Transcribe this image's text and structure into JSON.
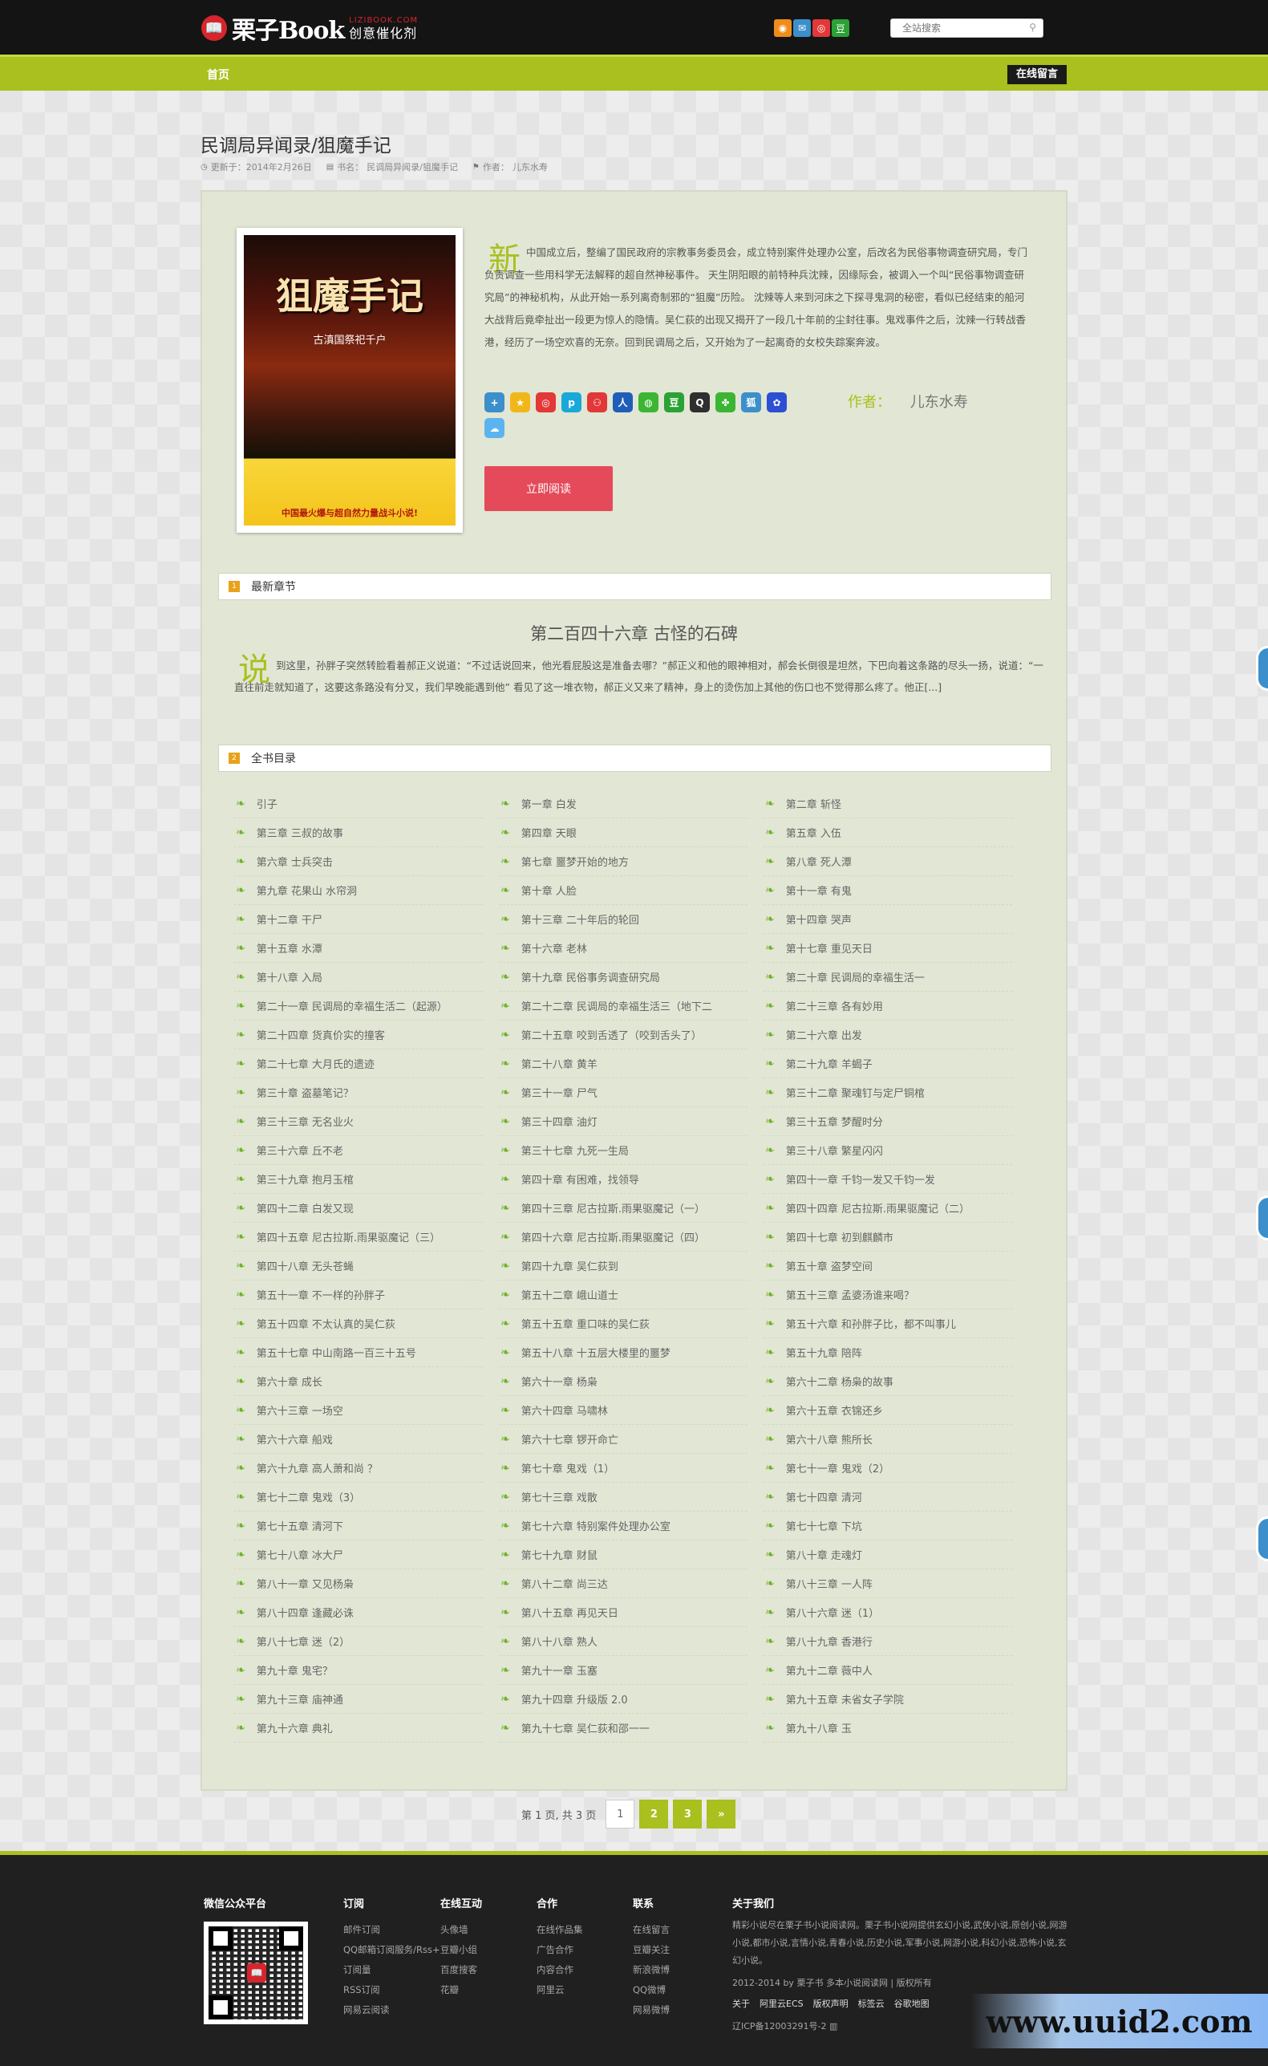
{
  "header": {
    "logo_main": "栗子Book",
    "logo_url": "LIZIBOOK.COM",
    "logo_slogan": "创意催化剂",
    "social": [
      {
        "name": "rss-icon",
        "color": "#f08c1b",
        "glyph": "◉"
      },
      {
        "name": "mail-icon",
        "color": "#3c8fcb",
        "glyph": "✉"
      },
      {
        "name": "weibo-icon",
        "color": "#e23838",
        "glyph": "◎"
      },
      {
        "name": "douban-icon",
        "color": "#2aa235",
        "glyph": "豆"
      }
    ],
    "search_placeholder": "全站搜索"
  },
  "nav": {
    "home": "首页",
    "message": "在线留言"
  },
  "article": {
    "title": "民调局异闻录/狙魔手记",
    "updated": "更新于：2014年2月26日",
    "book_label": "书名：",
    "book_name": "民调局异闻录/狙魔手记",
    "author_label": "作者：",
    "author_name": "儿东水寿"
  },
  "book": {
    "cover_title": "狙魔手记",
    "cover_sub": "古滇国祭祀千户",
    "cover_banner": "中国最火爆与超自然力量战斗小说!",
    "desc_char": "新",
    "description": "中国成立后，整编了国民政府的宗教事务委员会，成立特别案件处理办公室，后改名为民俗事物调查研究局，专门负责调查一些用科学无法解释的超自然神秘事件。        天生阴阳眼的前特种兵沈辣，因缘际会，被调入一个叫“民俗事物调查研究局”的神秘机构，从此开始一系列离奇制邪的“狙魔”历险。        沈辣等人来到河床之下探寻鬼洞的秘密，看似已经结束的船河大战背后竟牵扯出一段更为惊人的隐情。吴仁荻的出现又揭开了一段几十年前的尘封往事。鬼戏事件之后，沈辣一行转战香港，经历了一场空欢喜的无奈。回到民调局之后，又开始为了一起离奇的女校失踪案奔波。",
    "author_label": "作者：",
    "author_name": "儿东水寿",
    "read_button": "立即阅读",
    "share_icons": [
      {
        "name": "share-plus-icon",
        "color": "#3c8fcb",
        "glyph": "+"
      },
      {
        "name": "qzone-icon",
        "color": "#f1b71a",
        "glyph": "★"
      },
      {
        "name": "weibo-share-icon",
        "color": "#e23838",
        "glyph": "◎"
      },
      {
        "name": "tencent-weibo-icon",
        "color": "#19a9d8",
        "glyph": "p"
      },
      {
        "name": "renren-icon",
        "color": "#e23838",
        "glyph": "⚇"
      },
      {
        "name": "people-icon",
        "color": "#1e5eb8",
        "glyph": "人"
      },
      {
        "name": "wechat-icon",
        "color": "#3db534",
        "glyph": "◍"
      },
      {
        "name": "douban-share-icon",
        "color": "#2aa235",
        "glyph": "豆"
      },
      {
        "name": "qq-icon",
        "color": "#2f2f2f",
        "glyph": "Q"
      },
      {
        "name": "kaixin-icon",
        "color": "#3db534",
        "glyph": "✤"
      },
      {
        "name": "sohu-icon",
        "color": "#3c8fcb",
        "glyph": "狐"
      },
      {
        "name": "baidu-icon",
        "color": "#2c4fd3",
        "glyph": "✿"
      },
      {
        "name": "cloud-icon",
        "color": "#5bb4ef",
        "glyph": "☁"
      }
    ]
  },
  "latest": {
    "section_num": "1",
    "section_label": "最新章节",
    "chapter_title": "第二百四十六章  古怪的石碑",
    "drop_char": "说",
    "excerpt": "到这里，孙胖子突然转脸看着郝正义说道：“不过话说回来，他光看屁股这是准备去哪？”郝正义和他的眼神相对，郝会长倒很是坦然，下巴向着这条路的尽头一扬，说道：“一直往前走就知道了，这要这条路没有分叉，我们早晚能遇到他”        看见了这一堆衣物，郝正义又来了精神，身上的烫伤加上其他的伤口也不觉得那么疼了。他正[...]"
  },
  "catalog": {
    "section_num": "2",
    "section_label": "全书目录",
    "chapters": [
      "引子",
      "第一章 白发",
      "第二章 斩怪",
      "第三章 三叔的故事",
      "第四章 天眼",
      "第五章 入伍",
      "第六章 士兵突击",
      "第七章 噩梦开始的地方",
      "第八章 死人潭",
      "第九章 花果山 水帘洞",
      "第十章 人脸",
      "第十一章 有鬼",
      "第十二章 干尸",
      "第十三章 二十年后的轮回",
      "第十四章 哭声",
      "第十五章 水潭",
      "第十六章 老林",
      "第十七章 重见天日",
      "第十八章 入局",
      "第十九章 民俗事务调查研究局",
      "第二十章 民调局的幸福生活一",
      "第二十一章 民调局的幸福生活二（起源）",
      "第二十二章 民调局的幸福生活三（地下二",
      "第二十三章 各有妙用",
      "第二十四章 货真价实的撞客",
      "第二十五章 咬到舌透了（咬到舌头了）",
      "第二十六章 出发",
      "第二十七章 大月氏的遗迹",
      "第二十八章 黄羊",
      "第二十九章 羊蝎子",
      "第三十章 盗墓笔记？",
      "第三十一章 尸气",
      "第三十二章 聚魂钉与定尸铜棺",
      "第三十三章 无名业火",
      "第三十四章 油灯",
      "第三十五章 梦醒时分",
      "第三十六章 丘不老",
      "第三十七章 九死一生局",
      "第三十八章 繁星闪闪",
      "第三十九章 抱月玉棺",
      "第四十章 有困难，找领导",
      "第四十一章 千钧一发又千钧一发",
      "第四十二章 白发又现",
      "第四十三章 尼古拉斯.雨果驱魔记（一）",
      "第四十四章 尼古拉斯.雨果驱魔记（二）",
      "第四十五章 尼古拉斯.雨果驱魔记（三）",
      "第四十六章 尼古拉斯.雨果驱魔记（四）",
      "第四十七章 初到麒麟市",
      "第四十八章 无头苍蝇",
      "第四十九章 吴仁荻到",
      "第五十章 盗梦空间",
      "第五十一章 不一样的孙胖子",
      "第五十二章 峨山道士",
      "第五十三章 孟婆汤谁来喝？",
      "第五十四章 不太认真的吴仁荻",
      "第五十五章 重口味的吴仁荻",
      "第五十六章 和孙胖子比，都不叫事儿",
      "第五十七章 中山南路一百三十五号",
      "第五十八章 十五层大楼里的噩梦",
      "第五十九章 陪阵",
      "第六十章 成长",
      "第六十一章 杨枭",
      "第六十二章 杨枭的故事",
      "第六十三章 一场空",
      "第六十四章 马啸林",
      "第六十五章 衣锦还乡",
      "第六十六章 船戏",
      "第六十七章 锣开命亡",
      "第六十八章 熊所长",
      "第六十九章 高人萧和尚 ？",
      "第七十章 鬼戏（1）",
      "第七十一章 鬼戏（2）",
      "第七十二章 鬼戏（3）",
      "第七十三章 戏散",
      "第七十四章 清河",
      "第七十五章 清河下",
      "第七十六章 特别案件处理办公室",
      "第七十七章 下坑",
      "第七十八章 冰大尸",
      "第七十九章 财鼠",
      "第八十章 走魂灯",
      "第八十一章 又见杨枭",
      "第八十二章 尚三达",
      "第八十三章 一人阵",
      "第八十四章 逢藏必诛",
      "第八十五章 再见天日",
      "第八十六章 迷（1）",
      "第八十七章 迷（2）",
      "第八十八章 熟人",
      "第八十九章 香港行",
      "第九十章 鬼宅？",
      "第九十一章 玉塞",
      "第九十二章 薇中人",
      "第九十三章 庙神通",
      "第九十四章 升级版 2.0",
      "第九十五章 未省女子学院",
      "第九十六章 典礼",
      "第九十七章 吴仁荻和邵一一",
      "第九十八章 玉"
    ]
  },
  "pager": {
    "info": "第 1 页, 共 3 页",
    "pages": [
      "1",
      "2",
      "3",
      "»"
    ]
  },
  "footer": {
    "wechat_title": "微信公众平台",
    "columns": [
      {
        "title": "订阅",
        "links": [
          "邮件订阅",
          "QQ邮箱订阅服务/Rss+",
          "订阅量",
          "RSS订阅",
          "网易云阅读"
        ]
      },
      {
        "title": "在线互动",
        "links": [
          "头像墙",
          "豆瓣小组",
          "百度搜客",
          "花瓣"
        ]
      },
      {
        "title": "合作",
        "links": [
          "在线作品集",
          "广告合作",
          "内容合作",
          "阿里云"
        ]
      },
      {
        "title": "联系",
        "links": [
          "在线留言",
          "豆瓣关注",
          "新浪微博",
          "QQ微博",
          "网易微博"
        ]
      }
    ],
    "about_title": "关于我们",
    "about_text": "精彩小说尽在栗子书小说阅读网。栗子书小说网提供玄幻小说,武侠小说,原创小说,网游小说,都市小说,言情小说,青春小说,历史小说,军事小说,网游小说,科幻小说,恐怖小说,玄幻小说。",
    "copyright": "2012-2014 by 栗子书 多本小说阅读网 | 版权所有",
    "links": [
      "关于",
      "阿里云ECS",
      "版权声明",
      "标签云",
      "谷歌地图"
    ],
    "icp": "辽ICP备12003291号-2"
  },
  "watermark": "www.uuid2.com"
}
